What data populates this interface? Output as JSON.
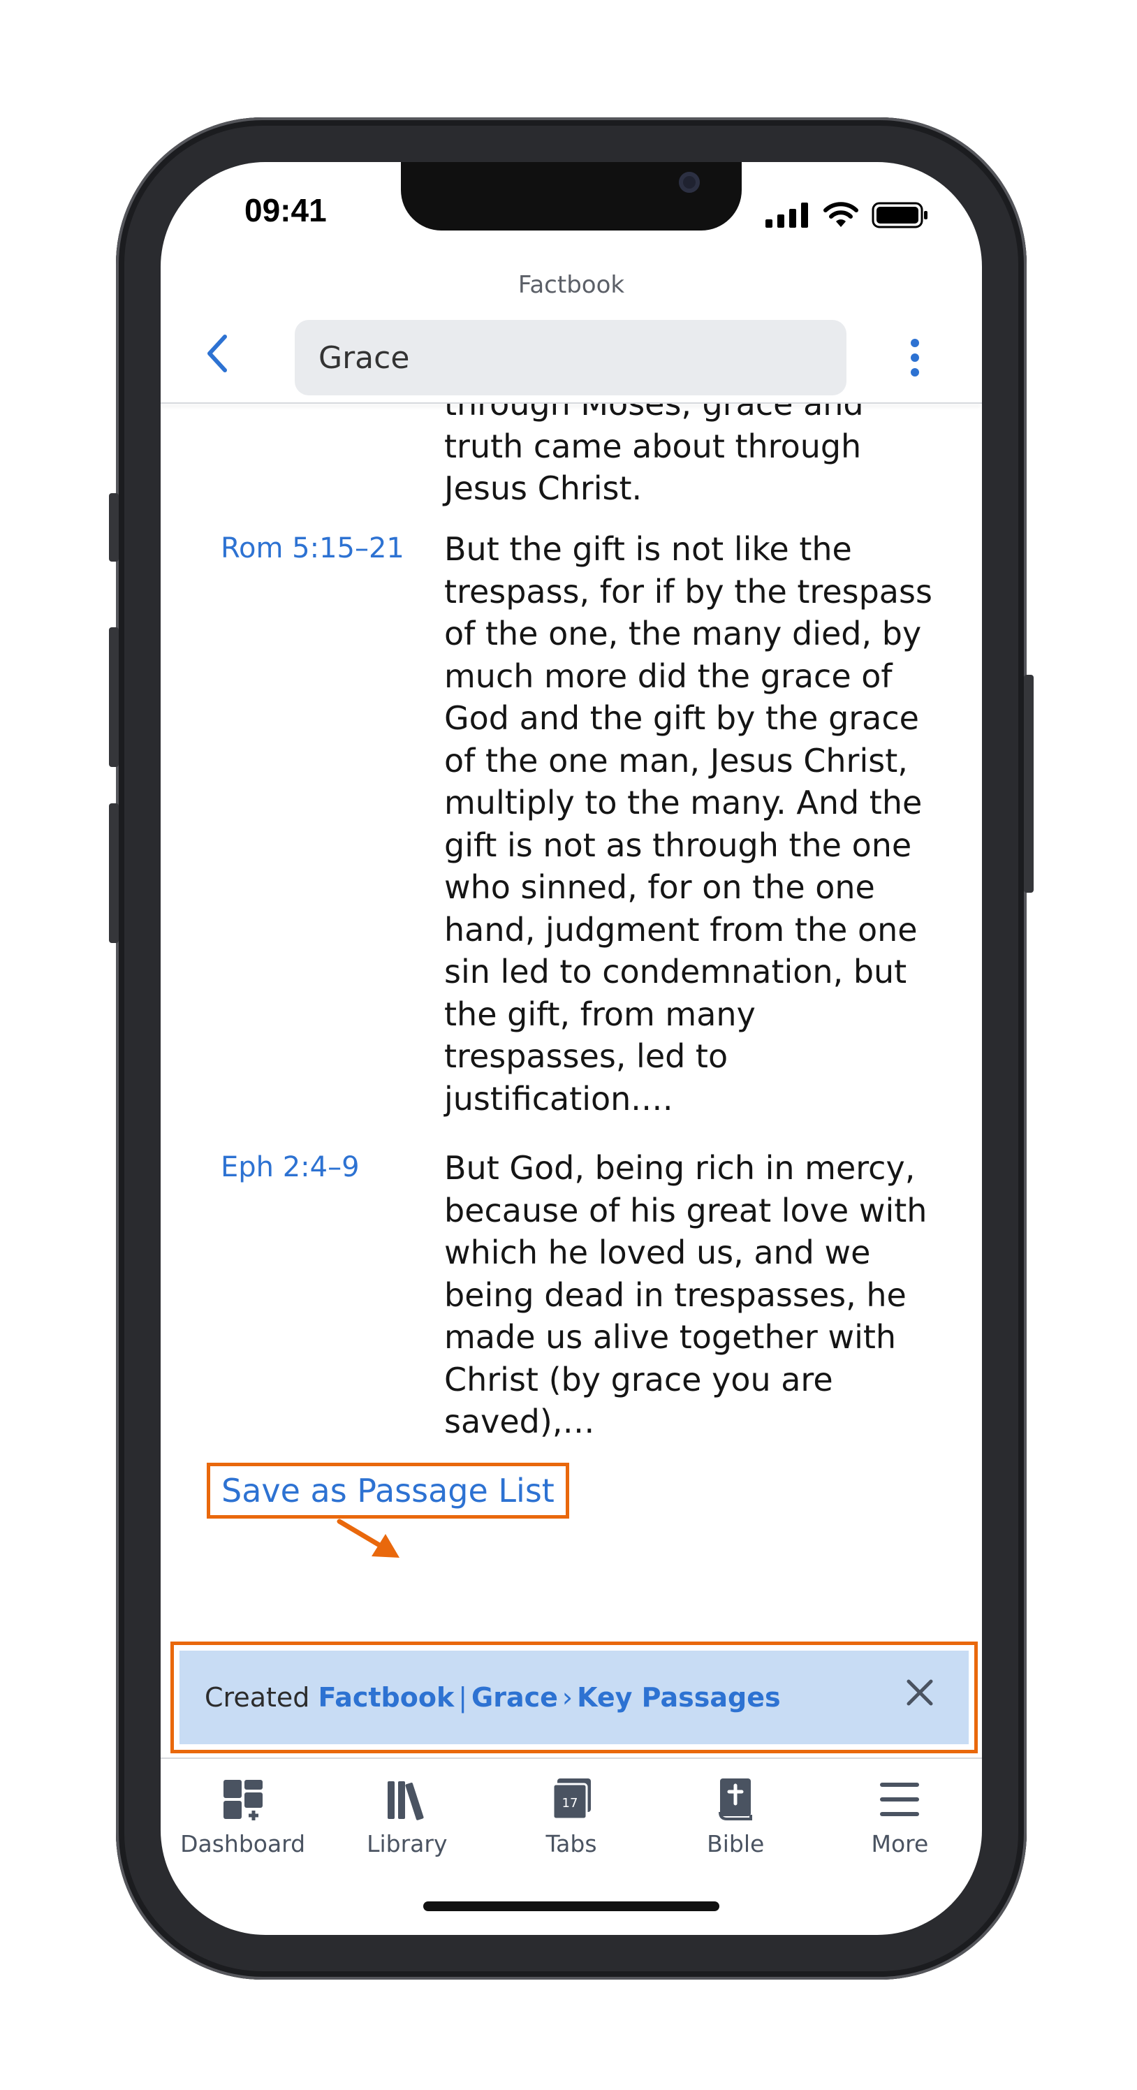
{
  "status": {
    "time": "09:41"
  },
  "header": {
    "app_title": "Factbook",
    "search_value": "Grace",
    "search_placeholder": "Grace"
  },
  "passages": [
    {
      "ref": "",
      "text": "through Moses; grace and\ntruth came about through\nJesus Christ."
    },
    {
      "ref": "Rom 5:15–21",
      "text": "But the gift is not like the\ntrespass, for if by the trespass\nof the one, the many died, by\nmuch more did the grace of\nGod and the gift by the grace\nof the one man, Jesus Christ,\nmultiply to the many. And the\ngift is not as through the one\nwho sinned, for on the one\nhand, judgment from the one\nsin led to condemnation, but\nthe gift, from many\ntrespasses, led to\njustification.…"
    },
    {
      "ref": "Eph 2:4–9",
      "text": "But God, being rich in mercy,\nbecause of his great love with\nwhich he loved us, and we\nbeing dead in trespasses, he\nmade us alive together with\nChrist (by grace you are\nsaved),…"
    }
  ],
  "save_link": "Save as Passage List",
  "toast": {
    "prefix": "Created",
    "link1": "Factbook",
    "sep1": "|",
    "link2": "Grace",
    "sep2": "›",
    "link3": "Key Passages"
  },
  "tabs": [
    {
      "label": "Dashboard",
      "icon": "dashboard-icon"
    },
    {
      "label": "Library",
      "icon": "library-icon"
    },
    {
      "label": "Tabs",
      "icon": "tabs-icon",
      "badge": "17"
    },
    {
      "label": "Bible",
      "icon": "bible-icon"
    },
    {
      "label": "More",
      "icon": "menu-icon"
    }
  ],
  "colors": {
    "accent": "#2d72d2",
    "highlight": "#e9680c",
    "toast_bg": "#c8dcf4"
  }
}
